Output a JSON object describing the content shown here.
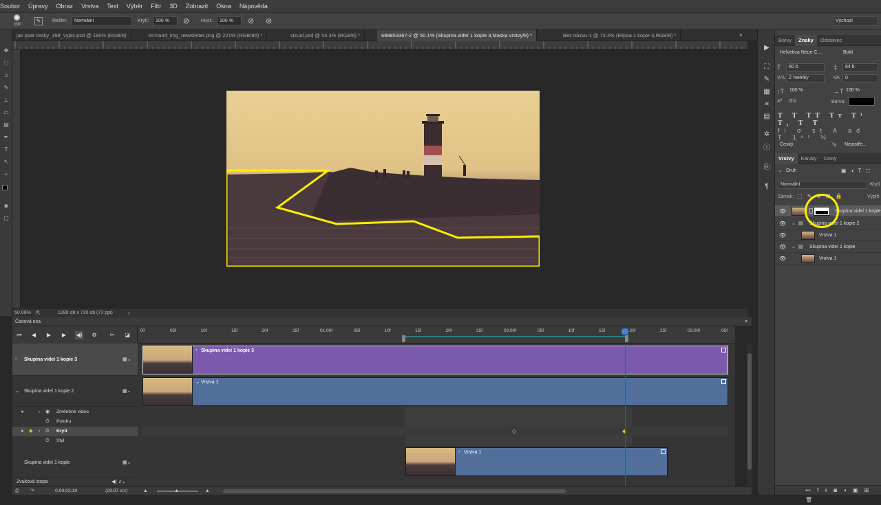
{
  "menu": [
    "Soubor",
    "Úpravy",
    "Obraz",
    "Vrstva",
    "Text",
    "Výběr",
    "Filtr",
    "3D",
    "Zobrazit",
    "Okna",
    "Nápověda"
  ],
  "options": {
    "brush_size": "190",
    "mode_label": "Režim:",
    "mode_value": "Normální",
    "opacity_label": "Krytí:",
    "opacity_value": "100 %",
    "flow_label": "Hust.:",
    "flow_value": "100 %",
    "workspace": "Výchozí"
  },
  "doc_tabs": [
    {
      "label": "jak psat cesky_398_vypis.psd @ 180% (RGB/8)",
      "active": false
    },
    {
      "label": "ks-hand_img_newsletter.png @ 221% (RGB/8#) *",
      "active": false
    },
    {
      "label": "vizual.psd @ 54.3% (RGB/8) *",
      "active": false
    },
    {
      "label": "698853367-2 @ 50.1% (Skupina videí 1 kopie 3,Maska vrstvy/8) *",
      "active": true
    },
    {
      "label": "Bez názvu-1 @ 73.3% (Elipsa 1 kopie 3,RGB/8) *",
      "active": false
    }
  ],
  "status": {
    "zoom": "50.09%",
    "doc_info": "1280 ob x 720 ob (72 ppi)"
  },
  "character_panel": {
    "tabs": [
      "Barvy",
      "Znaky",
      "Odstavec"
    ],
    "active_tab": "Znaky",
    "font_family": "Helvetica Neue C...",
    "font_style": "Bold",
    "font_size": "60 b",
    "leading": "64 b",
    "kerning": "Z metriky",
    "tracking": "0",
    "vscale": "100 %",
    "hscale": "100 %",
    "baseline": "0 b",
    "color_label": "Barva:",
    "color": "#000000",
    "language": "Český",
    "antialias": "Nejostře..."
  },
  "layers_panel": {
    "tabs": [
      "Vrstvy",
      "Kanály",
      "Cesty"
    ],
    "active_tab": "Vrstvy",
    "filter": "Druh",
    "blend": "Normální",
    "opacity_label": "Krytí",
    "lock_label": "Zámek:",
    "fill_label": "Výplň",
    "layers": [
      {
        "name": "Skupina videí 1 kopie 3",
        "indent": 0,
        "selected": true,
        "thumb": "image",
        "mask": true
      },
      {
        "name": "Skupina videí 1 kopie 2",
        "indent": 1,
        "selected": false,
        "thumb": "folder",
        "mask": false
      },
      {
        "name": "Vrstva 1",
        "indent": 2,
        "selected": false,
        "thumb": "image",
        "mask": false
      },
      {
        "name": "Skupina videí 1 kopie",
        "indent": 1,
        "selected": false,
        "thumb": "folder",
        "mask": false
      },
      {
        "name": "Vrstva 1",
        "indent": 2,
        "selected": false,
        "thumb": "image",
        "mask": false
      }
    ]
  },
  "timeline": {
    "title": "Časová osa",
    "ruler": [
      "00",
      "05f",
      "10f",
      "15f",
      "20f",
      "25f",
      "01:00f",
      "05f",
      "10f",
      "15f",
      "20f",
      "25f",
      "02:00f",
      "05f",
      "10f",
      "15f",
      "20f",
      "25f",
      "03:00f",
      "05f"
    ],
    "tracks": [
      {
        "name": "Skupina videí 1 kopie 3",
        "clip": "Skupina videí 1 kopie 3"
      },
      {
        "name": "Skupina videí 1 kopie 2",
        "clip": "Vrstva 1"
      },
      {
        "name": "Skupina videí 1 kopie",
        "clip": "Vrstva 1"
      }
    ],
    "properties": [
      "Změněné video",
      "Polohu",
      "Krytí",
      "Styl"
    ],
    "audio": "Zvuková stopa",
    "timecode": "0;00;02;19",
    "fps": "(29.97 s/s)"
  }
}
